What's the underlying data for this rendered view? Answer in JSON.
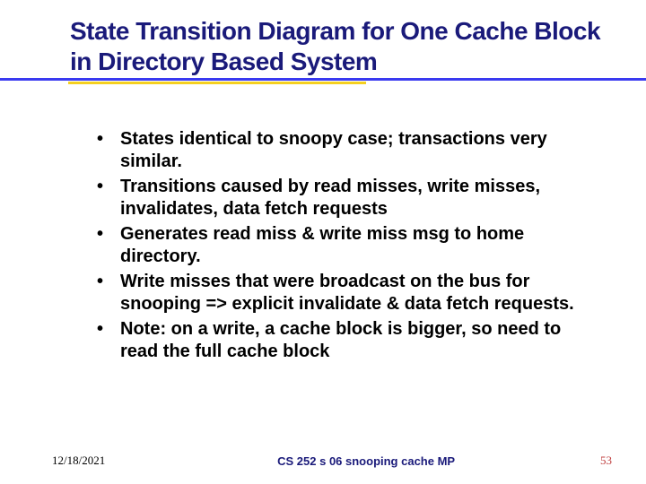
{
  "title": "State Transition Diagram for One Cache Block in Directory Based System",
  "bullets": [
    "States identical to snoopy case; transactions very similar.",
    "Transitions caused by read misses, write misses, invalidates, data fetch requests",
    "Generates read miss & write miss msg to home directory.",
    "Write misses that were broadcast on the bus for snooping => explicit invalidate & data fetch requests.",
    "Note: on a write, a cache block is bigger, so need to read the full cache block"
  ],
  "footer": {
    "date": "12/18/2021",
    "center": "CS 252 s 06 snooping cache MP",
    "page": "53"
  }
}
